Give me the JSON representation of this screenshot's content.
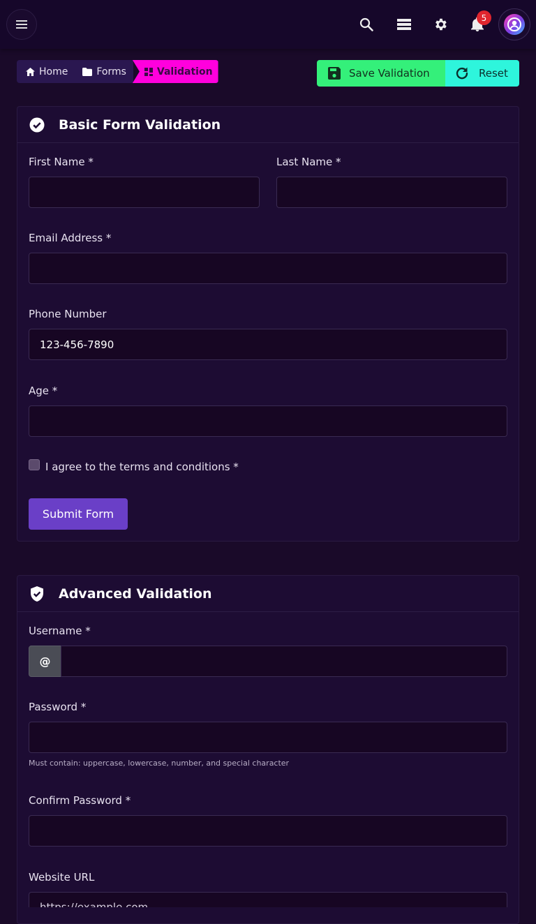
{
  "colors": {
    "background": "#1a0a29",
    "topbar": "#16072a",
    "breadcrumb_bg": "#2a1750",
    "breadcrumb_active": "#ff00dd",
    "save_button": "#34f07a",
    "reset_button": "#2ef5dc",
    "submit_button": "#6a3fc7",
    "badge": "#e0252e"
  },
  "topbar": {
    "menu_icon": "hamburger-icon",
    "icons": [
      "search-icon",
      "server-icon",
      "gear-icon",
      "bell-icon"
    ],
    "notification_count": "5",
    "avatar_icon": "user-avatar-icon"
  },
  "breadcrumb": {
    "items": [
      {
        "label": "Home",
        "icon": "home-icon"
      },
      {
        "label": "Forms",
        "icon": "folder-icon"
      },
      {
        "label": "Validation",
        "icon": "grid-icon"
      }
    ]
  },
  "actions": {
    "save_label": "Save Validation",
    "reset_label": "Reset"
  },
  "basic_form": {
    "title": "Basic Form Validation",
    "first_name_label": "First Name *",
    "last_name_label": "Last Name *",
    "email_label": "Email Address *",
    "phone_label": "Phone Number",
    "phone_value": "123-456-7890",
    "age_label": "Age *",
    "terms_label": "I agree to the terms and conditions *",
    "submit_label": "Submit Form"
  },
  "advanced_form": {
    "title": "Advanced Validation",
    "username_label": "Username *",
    "username_addon": "@",
    "password_label": "Password *",
    "password_hint": "Must contain: uppercase, lowercase, number, and special character",
    "confirm_password_label": "Confirm Password *",
    "website_label": "Website URL",
    "website_placeholder": "https://example.com"
  }
}
